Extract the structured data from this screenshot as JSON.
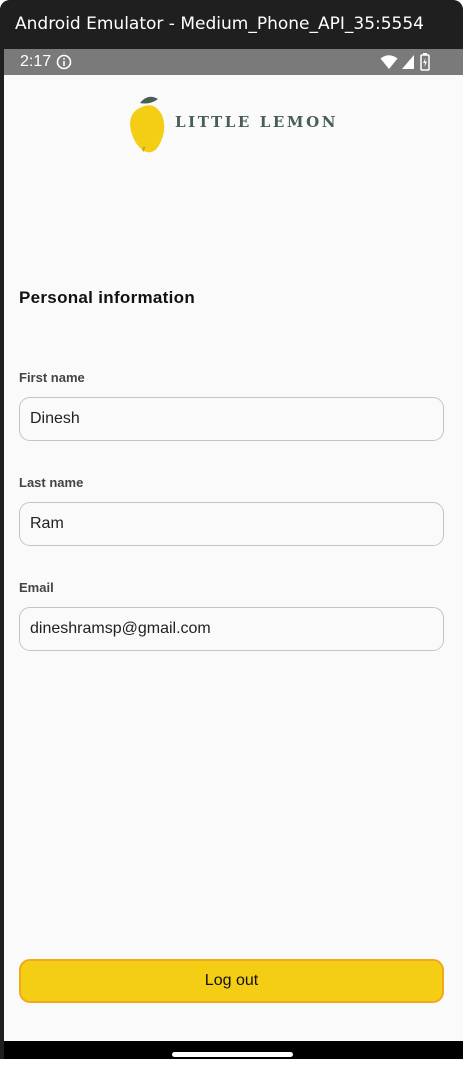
{
  "window": {
    "title": "Android Emulator - Medium_Phone_API_35:5554"
  },
  "status_bar": {
    "time": "2:17",
    "icons": [
      "info-icon",
      "wifi-icon",
      "signal-icon",
      "battery-icon"
    ]
  },
  "header": {
    "logo_text": "LITTLE LEMON",
    "logo_icon": "lemon-icon"
  },
  "profile": {
    "section_title": "Personal information",
    "first_name": {
      "label": "First name",
      "value": "Dinesh"
    },
    "last_name": {
      "label": "Last name",
      "value": "Ram"
    },
    "email": {
      "label": "Email",
      "value": "dineshramsp@gmail.com"
    }
  },
  "actions": {
    "logout_label": "Log out"
  },
  "colors": {
    "primary_yellow": "#F4CE14",
    "button_border": "#F0A81C",
    "logo_green": "#495E57",
    "background": "#FAFAFA"
  }
}
